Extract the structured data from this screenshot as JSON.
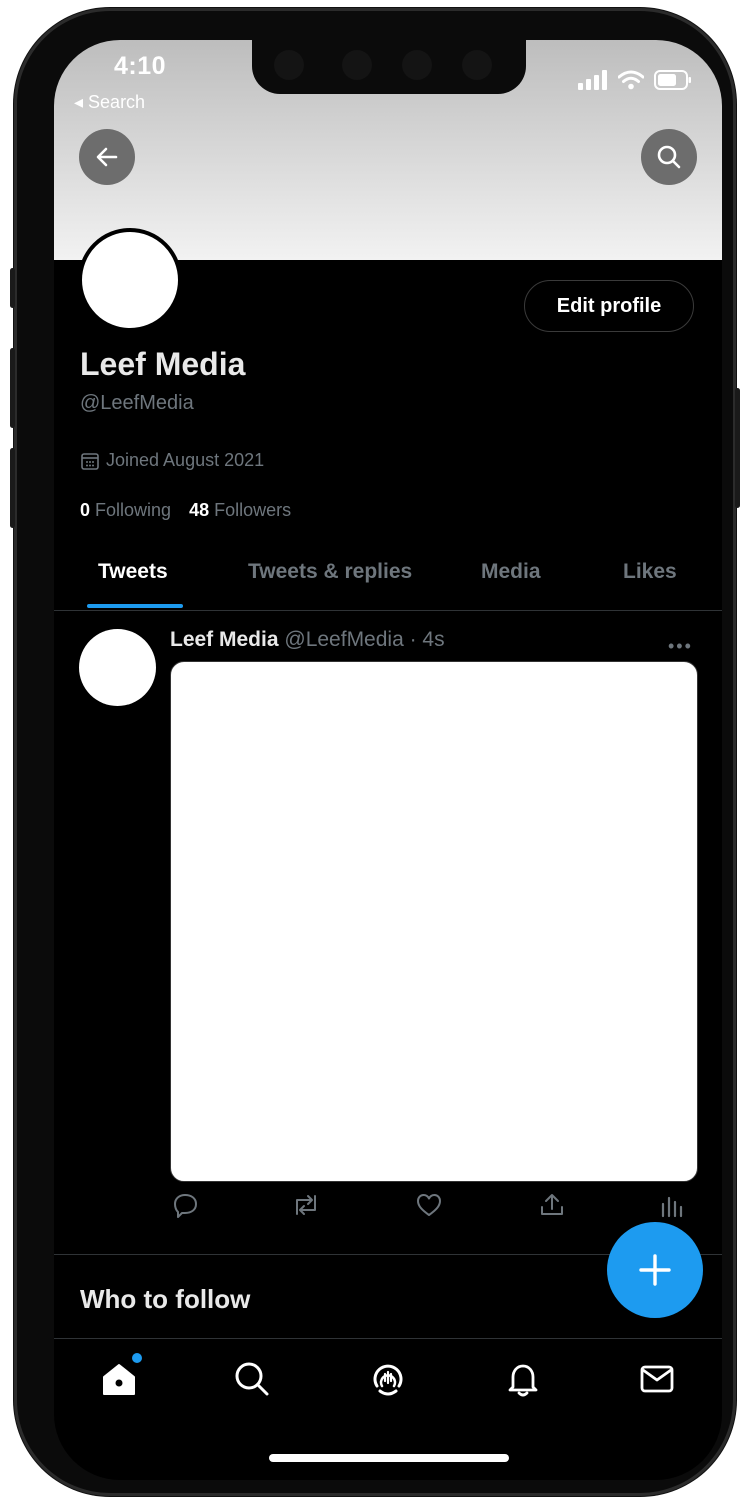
{
  "status_bar": {
    "time": "4:10",
    "back_app": "◂ Search"
  },
  "profile": {
    "display_name": "Leef Media",
    "handle": "@LeefMedia",
    "joined": "Joined August 2021",
    "following_count": "0",
    "following_label": "Following",
    "followers_count": "48",
    "followers_label": "Followers",
    "edit_label": "Edit profile"
  },
  "tabs": [
    {
      "label": "Tweets",
      "active": true
    },
    {
      "label": "Tweets & replies",
      "active": false
    },
    {
      "label": "Media",
      "active": false
    },
    {
      "label": "Likes",
      "active": false
    }
  ],
  "tweet": {
    "author": "Leef Media",
    "handle": "@LeefMedia",
    "time": "· 4s",
    "more": "•••"
  },
  "sections": {
    "who_to_follow": "Who to follow"
  },
  "colors": {
    "accent": "#1d9bf0",
    "muted": "#6e767d",
    "background": "#000000"
  },
  "icons": {
    "header": [
      "back-arrow-icon",
      "search-icon"
    ],
    "tweet_actions": [
      "reply-icon",
      "retweet-icon",
      "like-icon",
      "share-icon",
      "analytics-icon"
    ],
    "nav": [
      "home-icon",
      "search-icon",
      "spaces-icon",
      "notifications-icon",
      "messages-icon"
    ]
  }
}
